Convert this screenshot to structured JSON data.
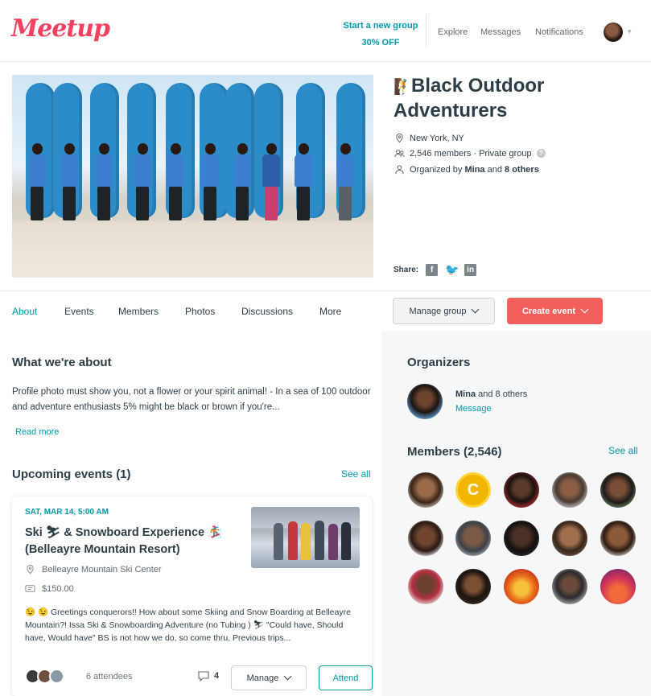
{
  "header": {
    "logo": "Meetup",
    "promo_line1": "Start a new group",
    "promo_line2": "30% OFF",
    "nav": [
      "Explore",
      "Messages",
      "Notifications"
    ]
  },
  "group": {
    "name": "Black Outdoor Adventurers",
    "location": "New York, NY",
    "members_privacy": "2,546 members · Private group",
    "organized_prefix": "Organized by ",
    "organized_name": "Mina",
    "organized_and": " and ",
    "organized_others": "8 others",
    "share_label": "Share:"
  },
  "tabs": [
    "About",
    "Events",
    "Members",
    "Photos",
    "Discussions",
    "More"
  ],
  "actions": {
    "manage_group": "Manage group",
    "create_event": "Create event"
  },
  "about": {
    "heading": "What we're about",
    "text": "Profile photo must show you, not a flower or your spirit animal! - In a sea of 100 outdoor and adventure enthusiasts 5% might be black or brown if you're...",
    "read_more": "Read more"
  },
  "upcoming": {
    "heading": "Upcoming events (1)",
    "see_all": "See all",
    "event": {
      "date": "SAT, MAR 14, 5:00 AM",
      "title": "Ski ⛷ & Snowboard Experience 🏂 (Belleayre Mountain Resort)",
      "venue": "Belleayre Mountain Ski Center",
      "price": "$150.00",
      "description": "😉 😉 Greetings conquerors!! How about some Skiing and Snow Boarding at Belleayre Mountain?! Issa Ski & Snowboarding Adventure (no Tubing ) ⛷ \"Could have, Should have, Would have\" BS is not how we do, so come thru. Previous trips...",
      "attendees": "6 attendees",
      "comments": "4",
      "manage": "Manage",
      "attend": "Attend"
    }
  },
  "organizers": {
    "heading": "Organizers",
    "name": "Mina",
    "and_others": " and 8 others",
    "message": "Message"
  },
  "members": {
    "heading": "Members (2,546)",
    "see_all": "See all",
    "c_initial": "C"
  },
  "colors": {
    "brand": "#f64060",
    "accent": "#0098ab",
    "create_button": "#f25f5c"
  }
}
